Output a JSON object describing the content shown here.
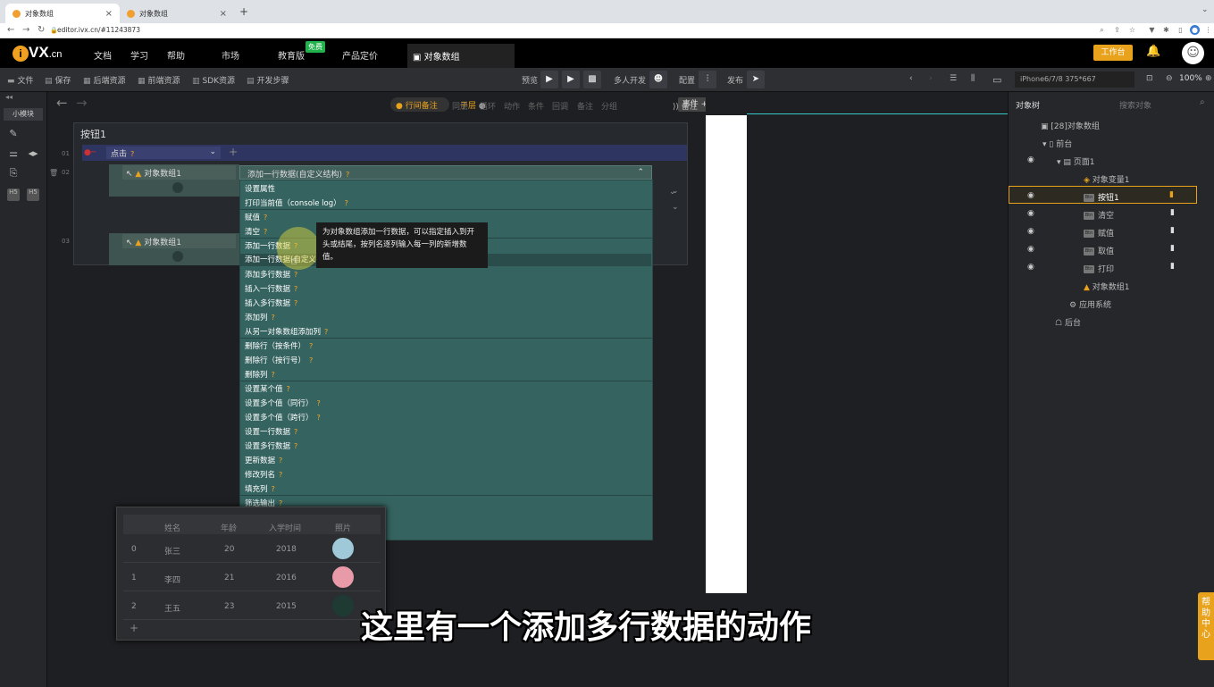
{
  "browser": {
    "tabs": [
      {
        "title": "对象数组",
        "active": true
      },
      {
        "title": "对象数组",
        "active": false
      }
    ],
    "new_tab": "+",
    "url": "editor.ivx.cn/#11243873"
  },
  "header": {
    "logo": "VX",
    "logo_suffix": ".cn",
    "nav": [
      "文档",
      "学习",
      "帮助",
      "市场",
      "教育版",
      "产品定价"
    ],
    "free_badge": "免费",
    "app_tab": "对象数组",
    "workbench": "工作台"
  },
  "toolbar": {
    "left": [
      "文件",
      "保存",
      "后端资源",
      "前端资源",
      "SDK资源",
      "开发步骤"
    ],
    "preview": "预览",
    "multi_dev": "多人开发",
    "config": "配置",
    "publish": "发布",
    "device": "iPhone6/7/8 375*667",
    "zoom": "100%"
  },
  "left_rail": {
    "small_module": "小模块",
    "h5_a": "H5",
    "h5_b": "H5"
  },
  "editor": {
    "line_note": "行间备注",
    "sublayer": "子层",
    "items": [
      "同层",
      "循环",
      "动作",
      "条件",
      "回调",
      "备注",
      "分组"
    ],
    "event_btn": "事件",
    "notes": "备注",
    "panel_title": "按钮1",
    "rows": {
      "r1": "01",
      "r2": "02",
      "r3": "03",
      "event": "点击",
      "object1": "对象数组1",
      "object2": "对象数组1",
      "action": "添加一行数据(自定义结构)"
    }
  },
  "dropdown": {
    "items": [
      "设置属性",
      "打印当前值（console log）",
      "赋值",
      "清空",
      "添加一行数据",
      "添加一行数据(自定义结构)",
      "添加多行数据",
      "插入一行数据",
      "插入多行数据",
      "添加列",
      "从另一对象数组添加列",
      "删除行（按条件）",
      "删除行（按行号）",
      "删除列",
      "设置某个值",
      "设置多个值（同行）",
      "设置多个值（跨行）",
      "设置一行数据",
      "设置多行数据",
      "更新数据",
      "修改列名",
      "填充列",
      "筛选输出"
    ],
    "help": "?",
    "tooltip": "为对象数组添加一行数据，可以指定插入到开头或结尾，按列名逐列输入每一列的新增数值。"
  },
  "table": {
    "headers": [
      "姓名",
      "年龄",
      "入学时间",
      "照片"
    ],
    "rows": [
      {
        "idx": "0",
        "name": "张三",
        "age": "20",
        "year": "2018"
      },
      {
        "idx": "1",
        "name": "李四",
        "age": "21",
        "year": "2016"
      },
      {
        "idx": "2",
        "name": "王五",
        "age": "23",
        "year": "2015"
      }
    ],
    "add": "+"
  },
  "right_panel": {
    "tab1": "对象树",
    "tab2": "搜索对象",
    "tree": {
      "root": "[28]对象数组",
      "front": "前台",
      "page": "页面1",
      "obj_var": "对象变量1",
      "btn": "按钮1",
      "clear": "清空",
      "assign": "赋值",
      "get": "取值",
      "print": "打印",
      "arr": "对象数组1",
      "system": "应用系统",
      "backend": "后台"
    },
    "help_tab": "帮助中心"
  },
  "subtitle": "这里有一个添加多行数据的动作",
  "colors": {
    "accent": "#e8a21c",
    "dropdown_bg": "#356360",
    "event_row": "#2e3560"
  }
}
